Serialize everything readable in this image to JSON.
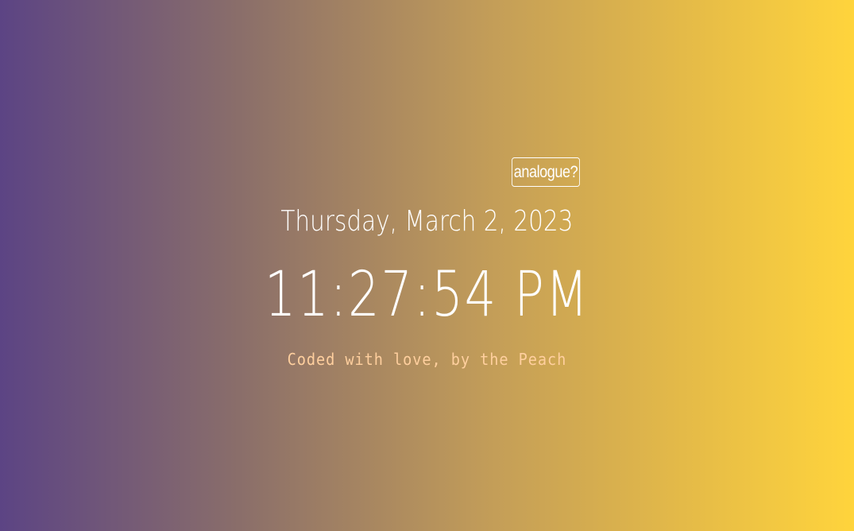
{
  "toggle": {
    "label": "analogue?"
  },
  "clock": {
    "date": "Thursday, March 2, 2023",
    "time": "11:27:54 PM"
  },
  "footer": {
    "credit": "Coded with love, by the Peach"
  },
  "colors": {
    "gradient_start": "#5c4484",
    "gradient_end": "#ffd43c",
    "text": "#ffffff",
    "credit_text": "#ffcf9e"
  }
}
